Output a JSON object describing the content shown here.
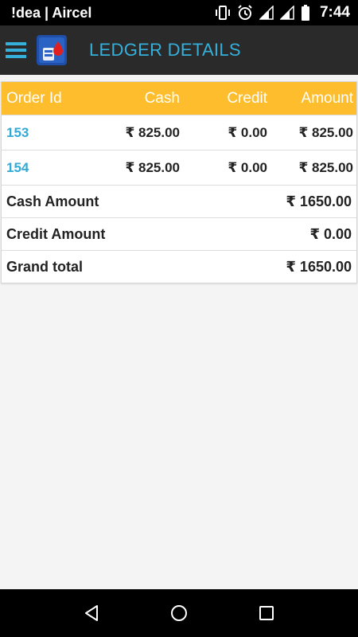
{
  "status_bar": {
    "carrier": "!dea | Aircel",
    "time": "7:44",
    "icons": [
      "vibrate-icon",
      "alarm-icon",
      "signal-icon",
      "signal-icon",
      "battery-icon"
    ]
  },
  "app_bar": {
    "title": "LEDGER DETAILS",
    "accent_color": "#35b0da"
  },
  "table": {
    "header_color": "#fdbd2c",
    "columns": [
      "Order Id",
      "Cash",
      "Credit",
      "Amount"
    ],
    "rows": [
      {
        "order_id": "153",
        "cash": "₹ 825.00",
        "credit": "₹ 0.00",
        "amount": "₹ 825.00"
      },
      {
        "order_id": "154",
        "cash": "₹ 825.00",
        "credit": "₹ 0.00",
        "amount": "₹ 825.00"
      }
    ],
    "summary": [
      {
        "label": "Cash Amount",
        "value": "₹ 1650.00"
      },
      {
        "label": "Credit Amount",
        "value": "₹ 0.00"
      },
      {
        "label": "Grand total",
        "value": "₹ 1650.00"
      }
    ]
  },
  "nav_bar": {
    "buttons": [
      "back-icon",
      "home-icon",
      "recents-icon"
    ]
  }
}
